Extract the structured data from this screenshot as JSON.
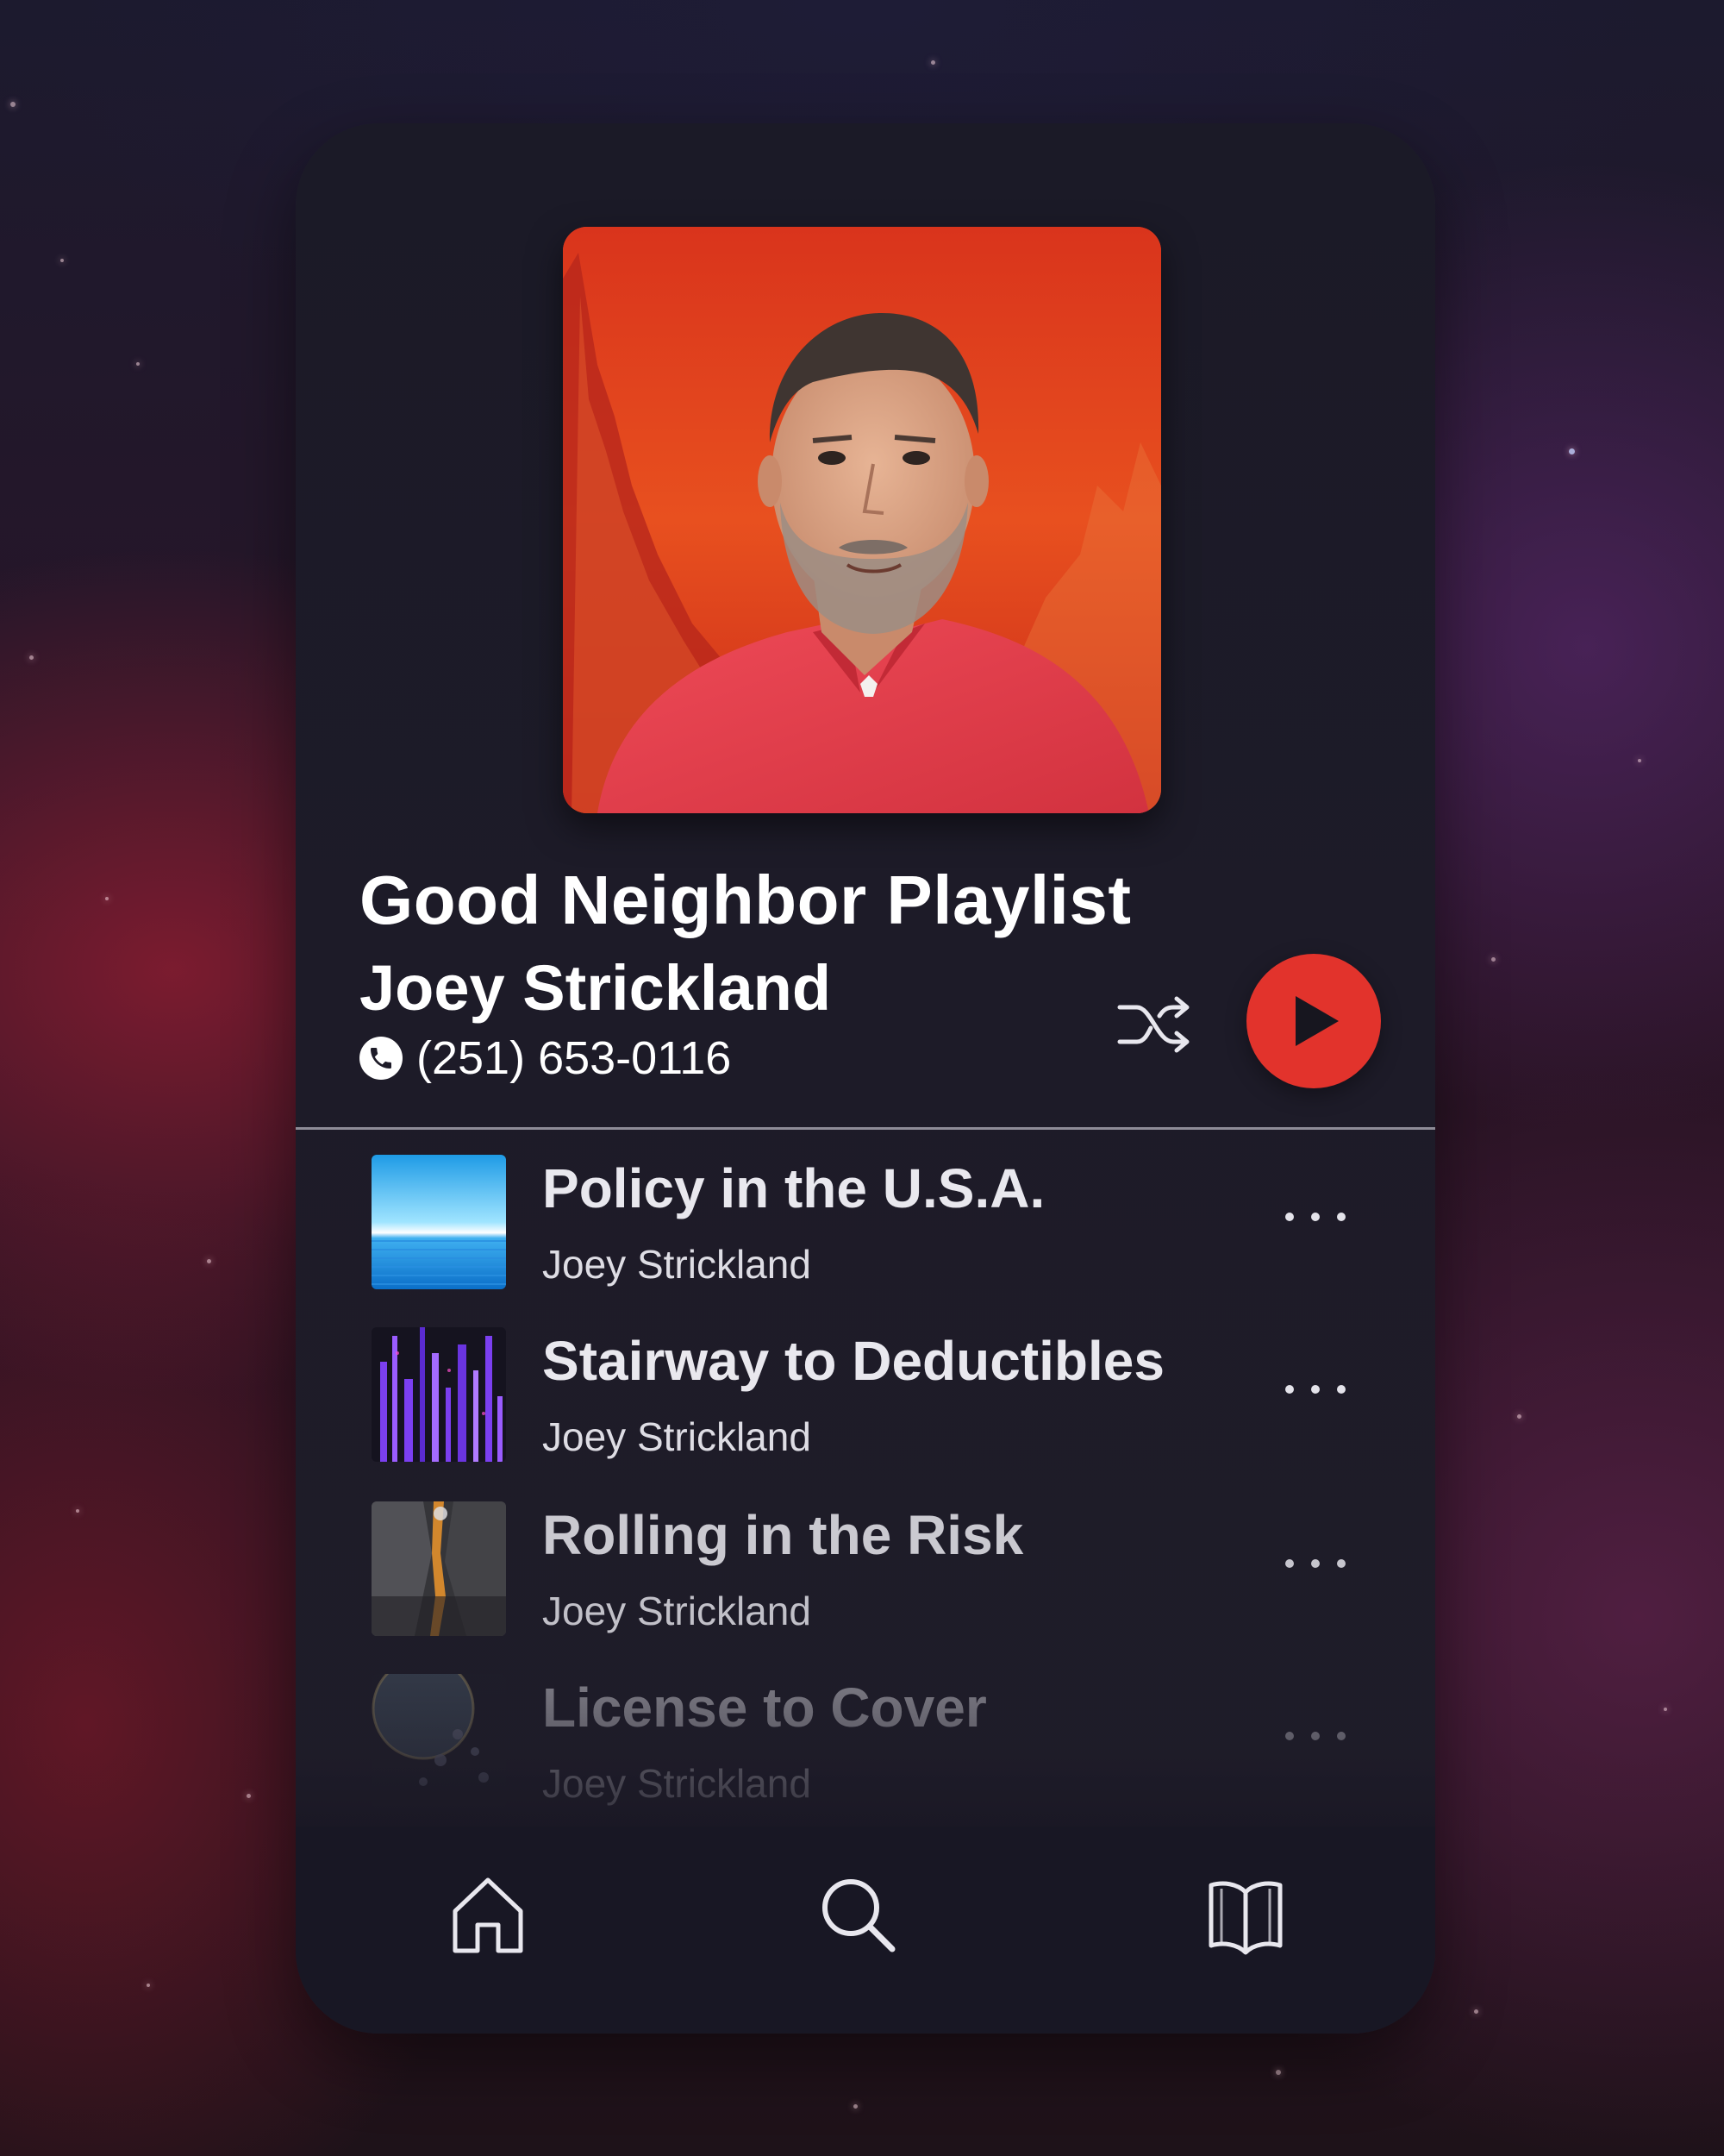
{
  "playlist": {
    "title": "Good Neighbor Playlist",
    "artist": "Joey Strickland",
    "phone": "(251) 653-0116",
    "cover_icon": "agent-portrait"
  },
  "controls": {
    "shuffle_icon": "shuffle-icon",
    "play_icon": "play-icon",
    "accent_color": "#e2332c"
  },
  "tracks": [
    {
      "name": "Policy in the U.S.A.",
      "artist": "Joey Strickland",
      "art": "ocean-horizon"
    },
    {
      "name": "Stairway to Deductibles",
      "artist": "Joey Strickland",
      "art": "purple-crystals"
    },
    {
      "name": "Rolling in the Risk",
      "artist": "Joey Strickland",
      "art": "canyon-lava"
    },
    {
      "name": "License to Cover",
      "artist": "Joey Strickland",
      "art": "planet-flowers"
    }
  ],
  "nav": {
    "items": [
      "home-icon",
      "search-icon",
      "library-icon"
    ]
  }
}
